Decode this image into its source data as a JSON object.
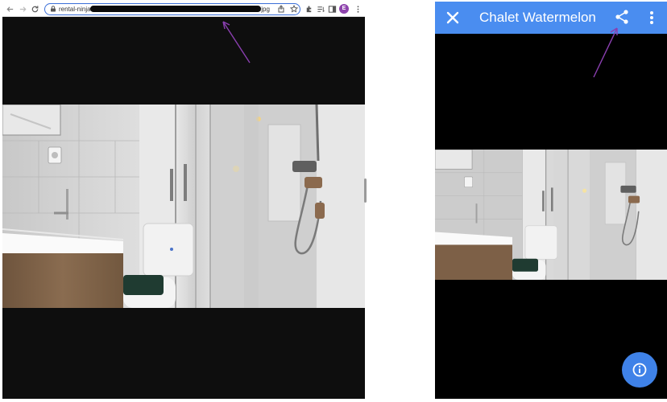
{
  "browser": {
    "url_prefix": "rental-ninja-",
    "url_suffix": ".jpg",
    "profile_initial": "E",
    "icons": [
      "back-icon",
      "forward-icon",
      "reload-icon",
      "lock-icon",
      "share-icon",
      "star-icon",
      "extensions-icon",
      "reading-list-icon",
      "side-panel-icon",
      "more-icon"
    ]
  },
  "viewer": {
    "title": "Chalet Watermelon",
    "icons": [
      "close-icon",
      "share-icon",
      "more-vert-icon",
      "info-icon"
    ]
  },
  "colors": {
    "appbar": "#4a8df0",
    "fab": "#3f82e8",
    "annotation": "#8a3fb0",
    "omnibox_border": "#3b6fd8"
  }
}
